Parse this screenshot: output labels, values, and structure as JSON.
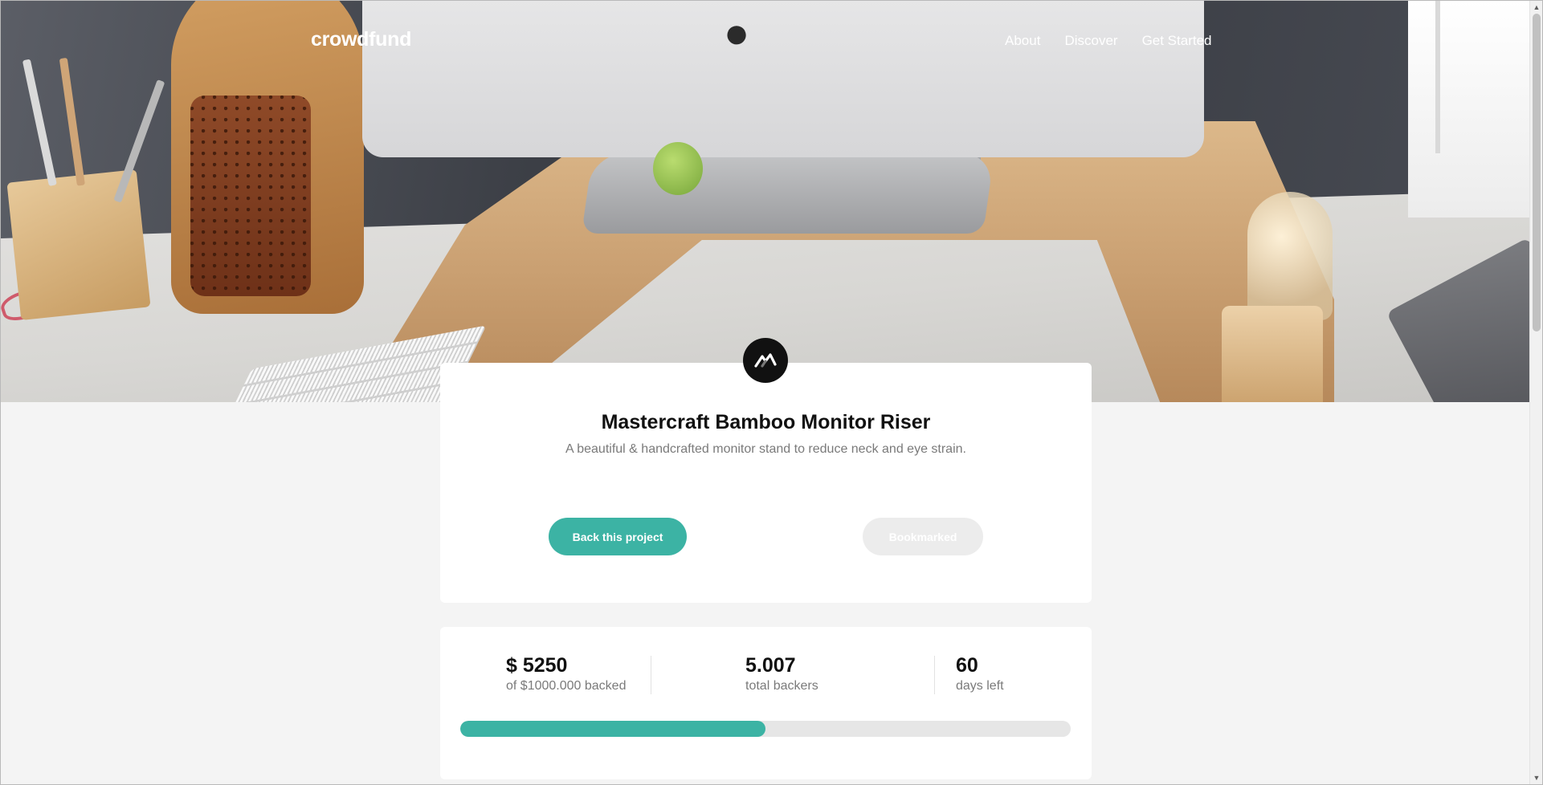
{
  "header": {
    "logo": "crowdfund",
    "nav": [
      {
        "label": "About"
      },
      {
        "label": "Discover"
      },
      {
        "label": "Get Started"
      }
    ]
  },
  "project": {
    "title": "Mastercraft Bamboo Monitor Riser",
    "description": "A beautiful & handcrafted monitor stand to reduce neck and eye strain.",
    "back_button": "Back this project",
    "bookmark_button": "Bookmarked"
  },
  "stats": {
    "backed_amount": "$ 5250",
    "backed_label": "of $1000.000 backed",
    "backers": "5.007",
    "backers_label": "total backers",
    "days": "60",
    "days_label": "days left",
    "progress_fraction": 0.5
  },
  "colors": {
    "accent": "#3cb3a4",
    "muted": "#ececec"
  },
  "icons": {
    "brand_logo": "mastercraft-logo-icon",
    "scroll_up": "scroll-up-arrow-icon",
    "scroll_down": "scroll-down-arrow-icon"
  }
}
